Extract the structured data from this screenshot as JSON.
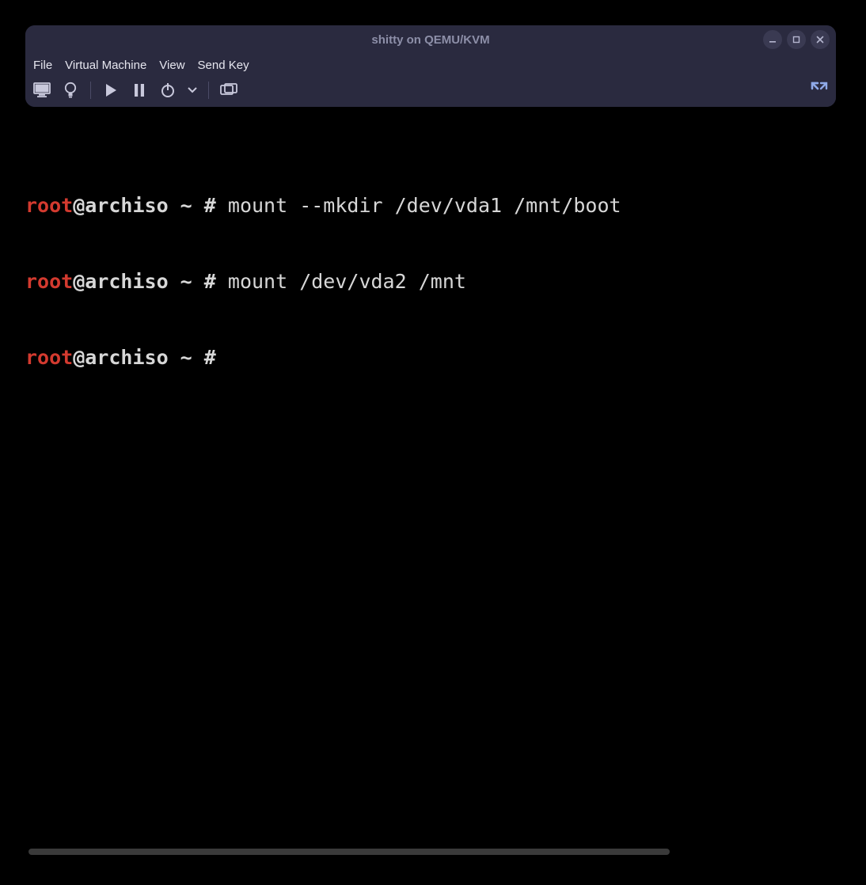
{
  "window": {
    "title": "shitty on QEMU/KVM"
  },
  "menubar": {
    "items": [
      "File",
      "Virtual Machine",
      "View",
      "Send Key"
    ]
  },
  "toolbar": {
    "icons": {
      "monitor": "monitor-icon",
      "info": "lightbulb-icon",
      "play": "play-icon",
      "pause": "pause-icon",
      "power": "power-icon",
      "dropdown": "chevron-down-icon",
      "screenshot": "screenshot-icon",
      "fullscreen": "fullscreen-icon"
    }
  },
  "terminal": {
    "lines": [
      {
        "user": "root",
        "host": "@archiso ~ # ",
        "cmd": "mount --mkdir /dev/vda1 /mnt/boot"
      },
      {
        "user": "root",
        "host": "@archiso ~ # ",
        "cmd": "mount /dev/vda2 /mnt"
      },
      {
        "user": "root",
        "host": "@archiso ~ # ",
        "cmd": ""
      }
    ]
  }
}
